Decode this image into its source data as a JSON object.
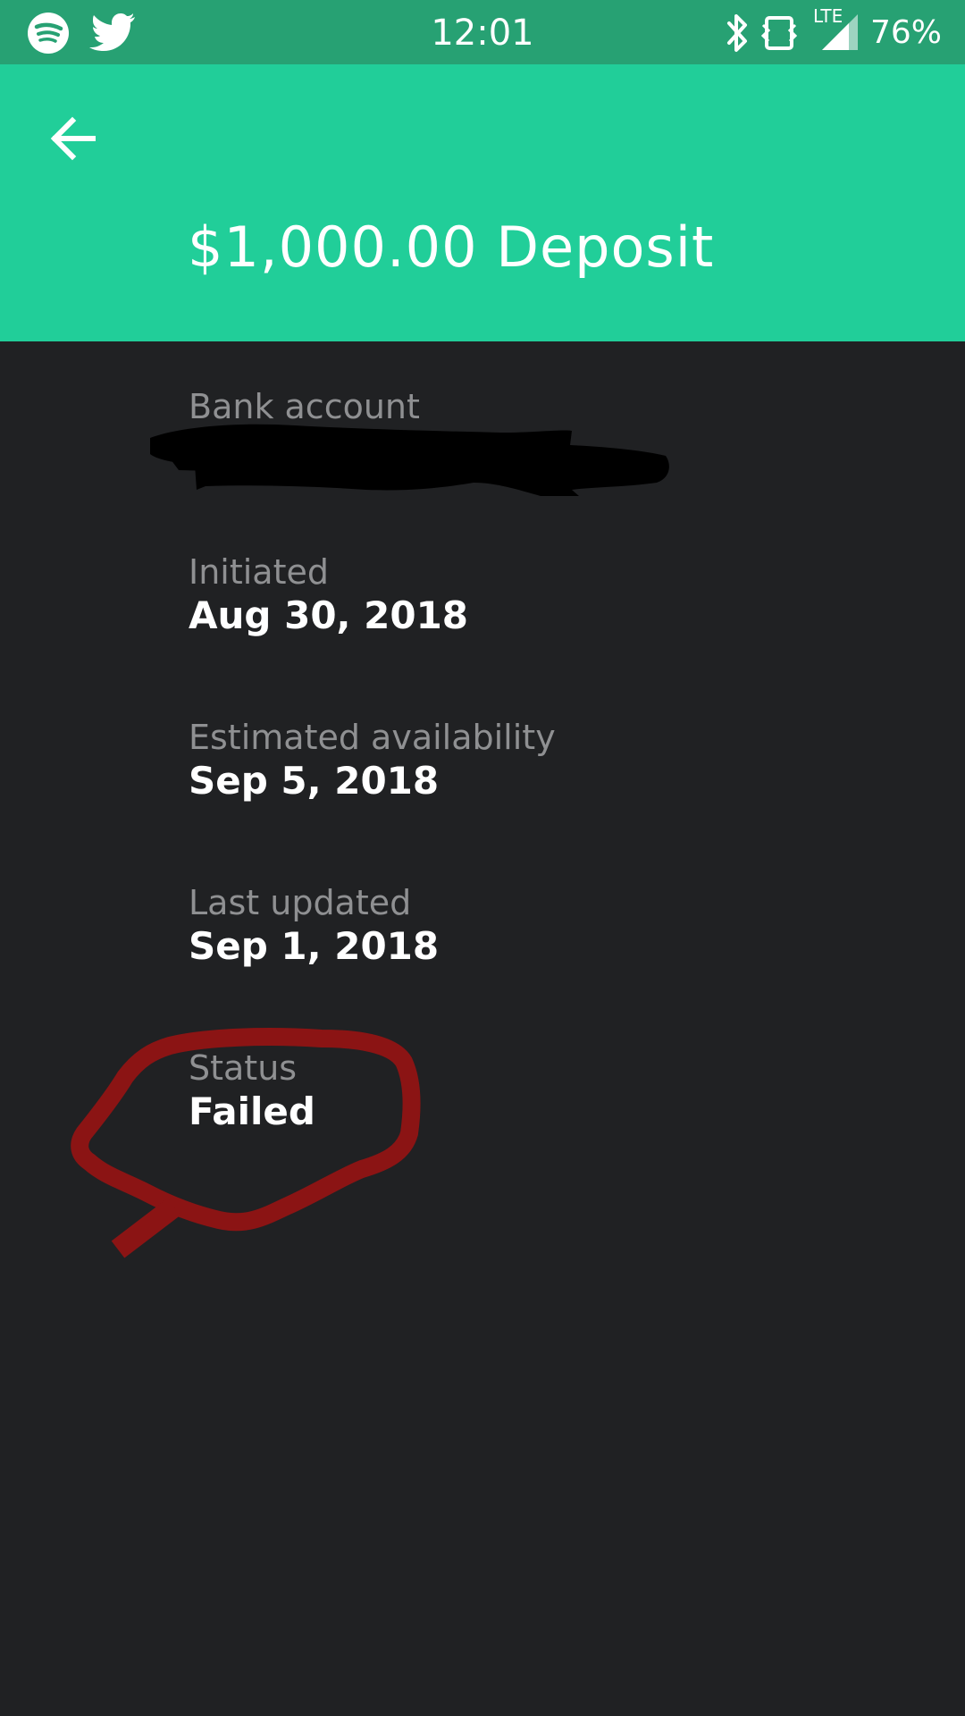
{
  "status_bar": {
    "time": "12:01",
    "battery": "76%",
    "network_label": "LTE",
    "left_icons": [
      "spotify-icon",
      "twitter-icon"
    ],
    "right_icons": [
      "bluetooth-icon",
      "vibrate-icon",
      "signal-icon"
    ]
  },
  "header": {
    "title": "$1,000.00 Deposit",
    "back_icon": "arrow-left-icon"
  },
  "fields": [
    {
      "label": "Bank account",
      "value": ""
    },
    {
      "label": "Initiated",
      "value": "Aug 30, 2018"
    },
    {
      "label": "Estimated availability",
      "value": "Sep 5, 2018"
    },
    {
      "label": "Last updated",
      "value": "Sep 1, 2018"
    },
    {
      "label": "Status",
      "value": "Failed"
    }
  ],
  "colors": {
    "accent": "#21ce99",
    "status_bar": "#27a173",
    "background": "#202123",
    "label": "#8f9092",
    "value": "#ffffff",
    "annotation": "#8b1414"
  }
}
